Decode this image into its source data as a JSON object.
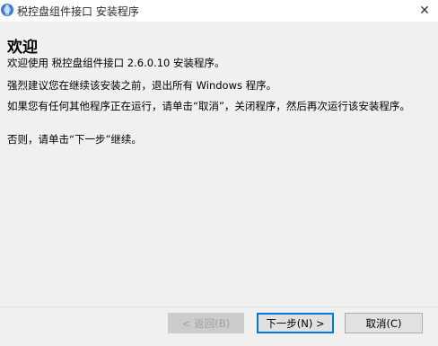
{
  "window": {
    "title": "税控盘组件接口 安装程序",
    "close_glyph": "✕"
  },
  "content": {
    "heading": "欢迎",
    "p1": "欢迎使用 税控盘组件接口 2.6.0.10 安装程序。",
    "p2": "强烈建议您在继续该安装之前，退出所有 Windows 程序。",
    "p3": "如果您有任何其他程序正在运行，请单击“取消”，关闭程序，然后再次运行该安装程序。",
    "p4": "否则，请单击“下一步”继续。"
  },
  "buttons": {
    "back": "< 返回(B)",
    "next": "下一步(N) >",
    "cancel": "取消(C)"
  },
  "colors": {
    "accent": "#0078d7",
    "window_bg": "#f0f0f0"
  }
}
